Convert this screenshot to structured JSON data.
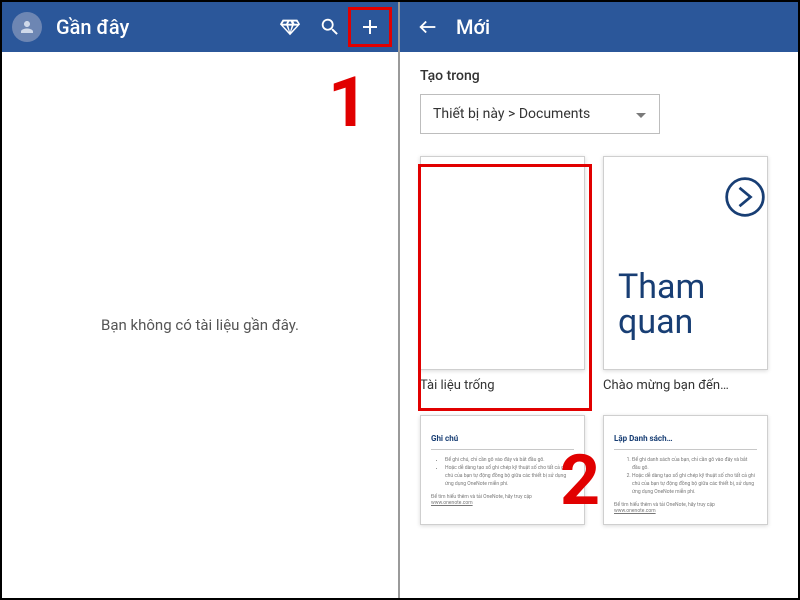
{
  "left": {
    "title": "Gần đây",
    "empty_message": "Bạn không có tài liệu gần đây."
  },
  "right": {
    "title": "Mới",
    "section_label": "Tạo trong",
    "dropdown_value": "Thiết bị này > Documents",
    "templates": [
      {
        "caption": "Tài liệu trống"
      },
      {
        "caption": "Chào mừng bạn đến…",
        "tour_text": "Tham quan"
      }
    ],
    "row2_docs": [
      {
        "title": "Ghi chú"
      },
      {
        "title": "Lập Danh sách…"
      }
    ]
  },
  "annotations": {
    "num1": "1",
    "num2": "2"
  }
}
